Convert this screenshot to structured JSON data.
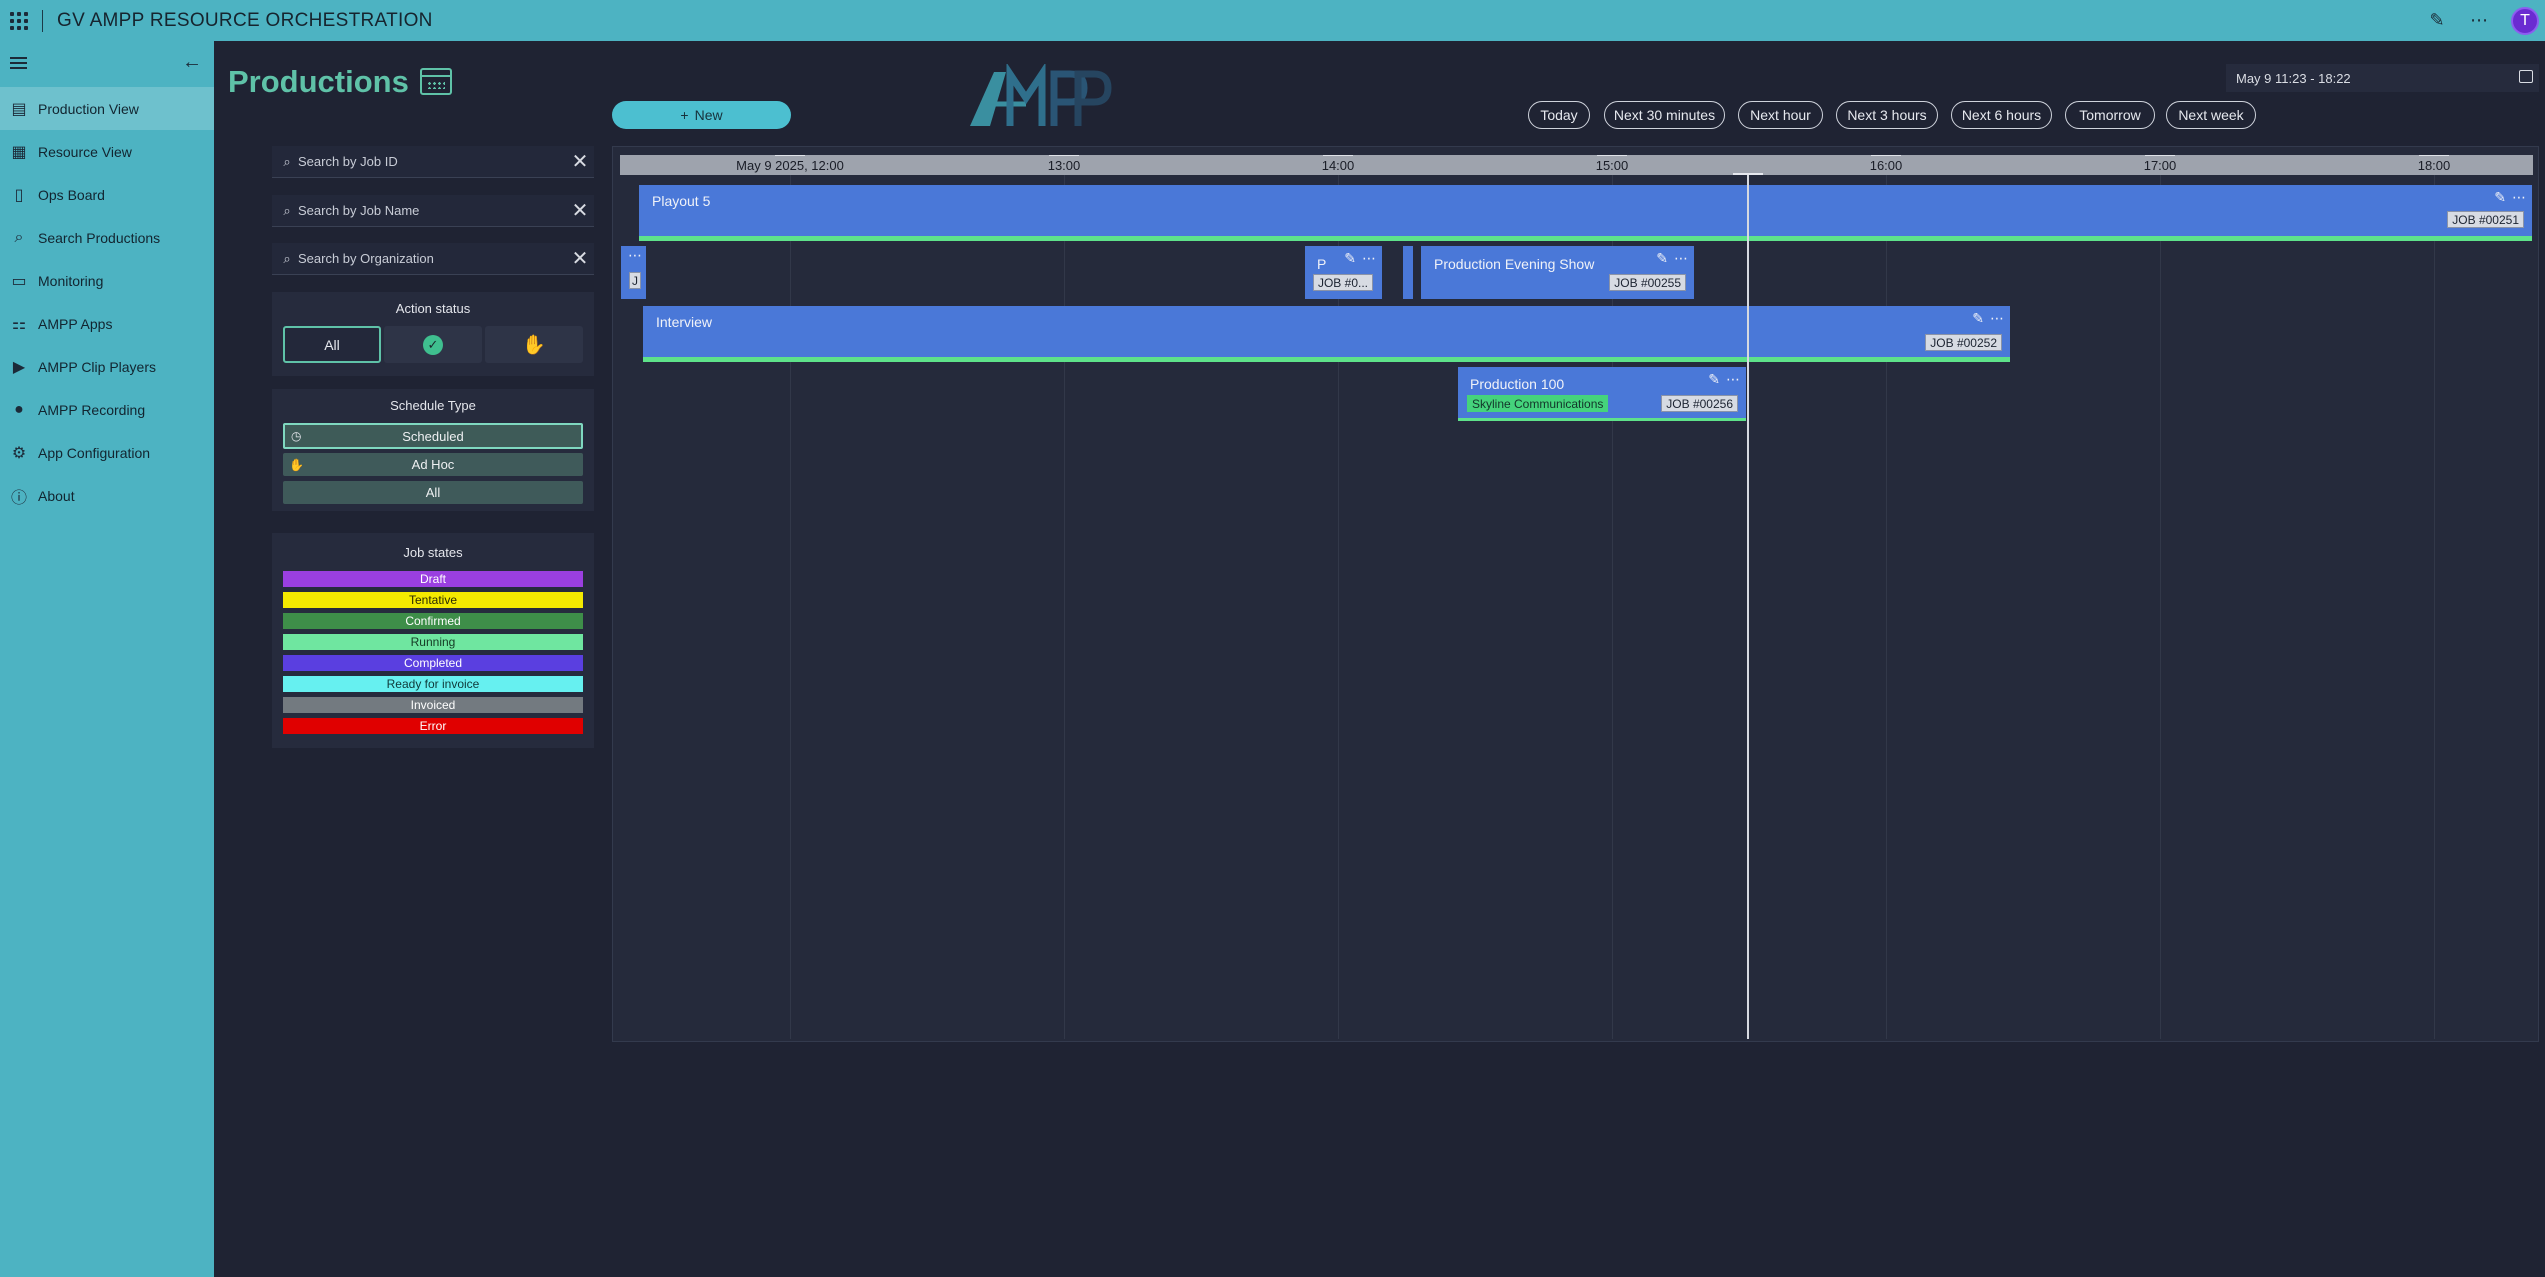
{
  "app": {
    "title": "GV AMPP RESOURCE ORCHESTRATION",
    "avatar_initial": "T"
  },
  "sidebar": {
    "items": [
      {
        "label": "Production View",
        "icon": "list-board-icon",
        "active": true
      },
      {
        "label": "Resource View",
        "icon": "grid-table-icon",
        "active": false
      },
      {
        "label": "Ops Board",
        "icon": "ops-board-icon",
        "active": false
      },
      {
        "label": "Search Productions",
        "icon": "search-icon",
        "active": false
      },
      {
        "label": "Monitoring",
        "icon": "monitor-icon",
        "active": false
      },
      {
        "label": "AMPP Apps",
        "icon": "apps-icon",
        "active": false
      },
      {
        "label": "AMPP Clip Players",
        "icon": "clip-player-icon",
        "active": false
      },
      {
        "label": "AMPP Recording",
        "icon": "recording-icon",
        "active": false
      },
      {
        "label": "App Configuration",
        "icon": "gear-icon",
        "active": false
      },
      {
        "label": "About",
        "icon": "info-icon",
        "active": false
      }
    ]
  },
  "page": {
    "title": "Productions",
    "new_label": "New"
  },
  "filters": {
    "search_job_id": "Search by Job ID",
    "search_job_name": "Search by Job Name",
    "search_org": "Search by Organization",
    "action_status": {
      "title": "Action status",
      "all_label": "All"
    },
    "schedule_type": {
      "title": "Schedule Type",
      "scheduled": "Scheduled",
      "adhoc": "Ad Hoc",
      "all": "All"
    },
    "job_states": {
      "title": "Job states",
      "items": [
        {
          "label": "Draft",
          "bg": "#9a3fe0",
          "fg": "#ffffff"
        },
        {
          "label": "Tentative",
          "bg": "#f4ea00",
          "fg": "#2a2a00"
        },
        {
          "label": "Confirmed",
          "bg": "#3e8e49",
          "fg": "#ffffff"
        },
        {
          "label": "Running",
          "bg": "#6fe6a0",
          "fg": "#153a24"
        },
        {
          "label": "Completed",
          "bg": "#5a3fe0",
          "fg": "#ffffff"
        },
        {
          "label": "Ready for invoice",
          "bg": "#66f0f0",
          "fg": "#0f3a3a"
        },
        {
          "label": "Invoiced",
          "bg": "#737a80",
          "fg": "#ffffff"
        },
        {
          "label": "Error",
          "bg": "#e00000",
          "fg": "#ffffff"
        }
      ]
    }
  },
  "quick_ranges": [
    "Today",
    "Next 30 minutes",
    "Next hour",
    "Next 3 hours",
    "Next 6 hours",
    "Tomorrow",
    "Next week"
  ],
  "date_range": "May 9 11:23 - 18:22",
  "timeline": {
    "ticks": [
      "May 9 2025, 12:00",
      "13:00",
      "14:00",
      "15:00",
      "16:00",
      "17:00",
      "18:00"
    ],
    "jobs": [
      {
        "name": "Playout 5",
        "job": "JOB #00251"
      },
      {
        "name": "",
        "job": "J"
      },
      {
        "name": "P",
        "job": "JOB #0..."
      },
      {
        "name": "Production Evening Show",
        "job": "JOB #00255"
      },
      {
        "name": "Interview",
        "job": "JOB #00252"
      },
      {
        "name": "Production 100",
        "job": "JOB #00256",
        "org": "Skyline Communications"
      }
    ]
  },
  "colors": {
    "accent": "#4db3c2",
    "job_bar": "#4a78d8",
    "running": "#5ee28a",
    "title": "#5fc2a8"
  }
}
